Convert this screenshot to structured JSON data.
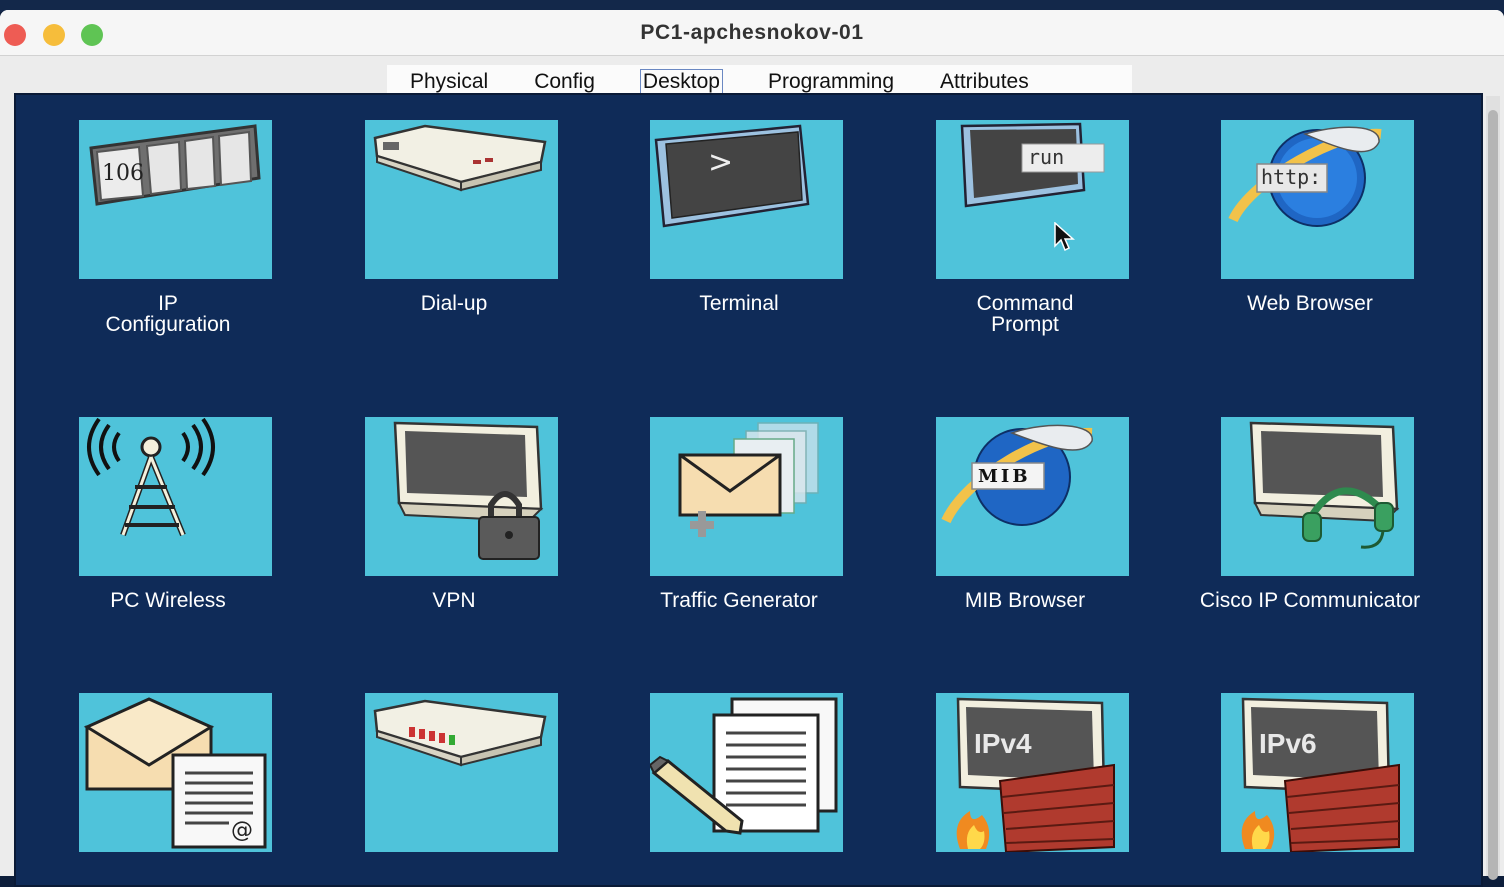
{
  "window": {
    "title": "PC1-apchesnokov-01"
  },
  "tabs": [
    {
      "label": "Physical"
    },
    {
      "label": "Config"
    },
    {
      "label": "Desktop",
      "active": true
    },
    {
      "label": "Programming"
    },
    {
      "label": "Attributes"
    }
  ],
  "apps": [
    {
      "label": "IP\nConfiguration",
      "icon": "ip-configuration-icon",
      "badge": "106"
    },
    {
      "label": "Dial-up",
      "icon": "modem-icon"
    },
    {
      "label": "Terminal",
      "icon": "terminal-icon",
      "badge": ">"
    },
    {
      "label": "Command\nPrompt",
      "icon": "command-prompt-icon",
      "badge": "run"
    },
    {
      "label": "Web Browser",
      "icon": "web-browser-icon",
      "badge": "http:"
    },
    {
      "label": "PC Wireless",
      "icon": "wireless-tower-icon"
    },
    {
      "label": "VPN",
      "icon": "vpn-lock-icon"
    },
    {
      "label": "Traffic Generator",
      "icon": "traffic-generator-icon"
    },
    {
      "label": "MIB Browser",
      "icon": "mib-browser-icon",
      "badge": "MIB"
    },
    {
      "label": "Cisco IP Communicator",
      "icon": "ip-communicator-icon"
    },
    {
      "label": "",
      "icon": "email-icon",
      "badge": "@"
    },
    {
      "label": "",
      "icon": "pppoe-dialer-icon"
    },
    {
      "label": "",
      "icon": "text-editor-icon"
    },
    {
      "label": "",
      "icon": "ipv4-firewall-icon",
      "badge": "IPv4"
    },
    {
      "label": "",
      "icon": "ipv6-firewall-icon",
      "badge": "IPv6"
    }
  ],
  "colors": {
    "desktop_bg": "#0f2b58",
    "tile_bg": "#4fc3da",
    "active_tab_underline": "#1e3d6e"
  }
}
